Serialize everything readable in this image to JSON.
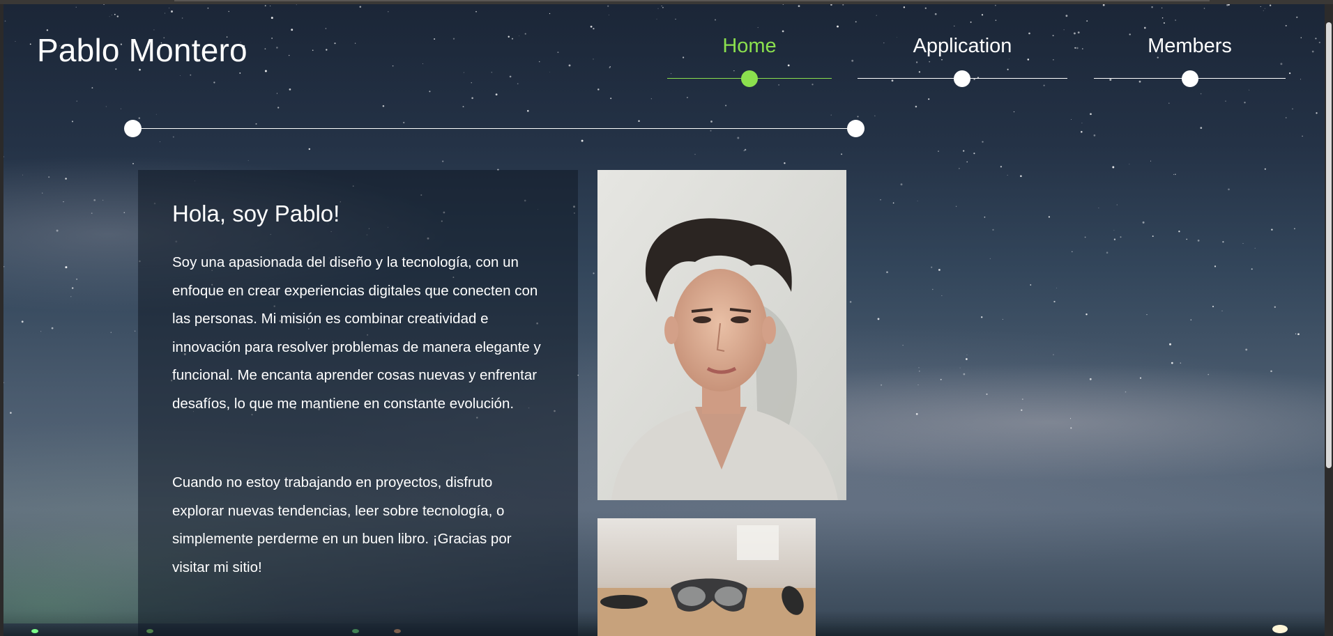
{
  "brand": {
    "name": "Pablo Montero"
  },
  "nav": {
    "items": [
      {
        "label": "Home",
        "active": true
      },
      {
        "label": "Application",
        "active": false
      },
      {
        "label": "Members",
        "active": false
      }
    ],
    "active_color": "#8be04e"
  },
  "intro": {
    "heading": "Hola, soy Pablo!",
    "paragraph1": "Soy una apasionada del diseño y la tecnología, con un enfoque en crear experiencias digitales que conecten con las personas. Mi misión es combinar creatividad e innovación para resolver problemas de manera elegante y funcional. Me encanta aprender cosas nuevas y enfrentar desafíos, lo que me mantiene en constante evolución.",
    "paragraph2": "Cuando no estoy trabajando en proyectos, disfruto explorar nuevas tendencias, leer sobre tecnología, o simplemente perderme en un buen libro. ¡Gracias por visitar mi sitio!"
  },
  "images": {
    "portrait": "portrait-photo",
    "second": "ar-glasses-photo"
  }
}
